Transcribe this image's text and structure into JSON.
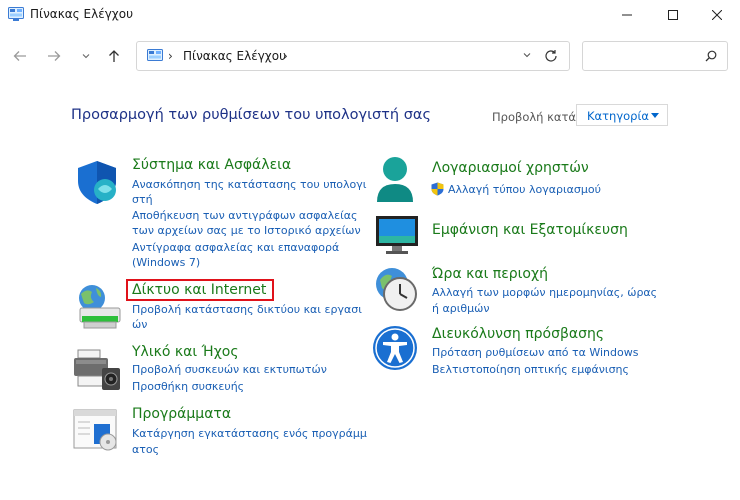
{
  "window": {
    "title": "Πίνακας Ελέγχου"
  },
  "address": {
    "breadcrumb": "Πίνακας Ελέγχου",
    "separator": "›"
  },
  "search": {
    "placeholder": ""
  },
  "header": {
    "title": "Προσαρμογή των ρυθμίσεων του υπολογιστή σας",
    "view_by_label": "Προβολή κατά:",
    "view_by_value": "Κατηγορία"
  },
  "categories": {
    "system": {
      "title": "Σύστημα και Ασφάλεια",
      "links": [
        "Ανασκόπηση της κατάστασης του υπολογι",
        "στή",
        "Αποθήκευση των αντιγράφων ασφαλείας",
        "των αρχείων σας με το Ιστορικό αρχείων",
        "Αντίγραφα ασφαλείας και επαναφορά",
        "(Windows 7)"
      ]
    },
    "network": {
      "title": "Δίκτυο και Internet",
      "links": [
        "Προβολή κατάστασης δικτύου και εργασι",
        "ών"
      ]
    },
    "hardware": {
      "title": "Υλικό και Ήχος",
      "links": [
        "Προβολή συσκευών και εκτυπωτών",
        "Προσθήκη συσκευής"
      ]
    },
    "programs": {
      "title": "Προγράμματα",
      "links": [
        "Κατάργηση εγκατάστασης ενός προγράμμ",
        "ατος"
      ]
    },
    "users": {
      "title": "Λογαριασμοί χρηστών",
      "links": [
        "Αλλαγή τύπου λογαριασμού"
      ]
    },
    "appearance": {
      "title": "Εμφάνιση και Εξατομίκευση",
      "links": []
    },
    "clock": {
      "title": "Ώρα και περιοχή",
      "links": [
        "Αλλαγή των μορφών ημερομηνίας, ώρας",
        "ή αριθμών"
      ]
    },
    "access": {
      "title": "Διευκόλυνση πρόσβασης",
      "links": [
        "Πρόταση ρυθμίσεων από τα Windows",
        "Βελτιστοποίηση οπτικής εμφάνισης"
      ]
    }
  },
  "colors": {
    "accent": "#0066cc",
    "heading_green": "#1a7a1a",
    "link_blue": "#1a5fb4",
    "title_blue": "#1e3287",
    "highlight": "#e0121a"
  }
}
